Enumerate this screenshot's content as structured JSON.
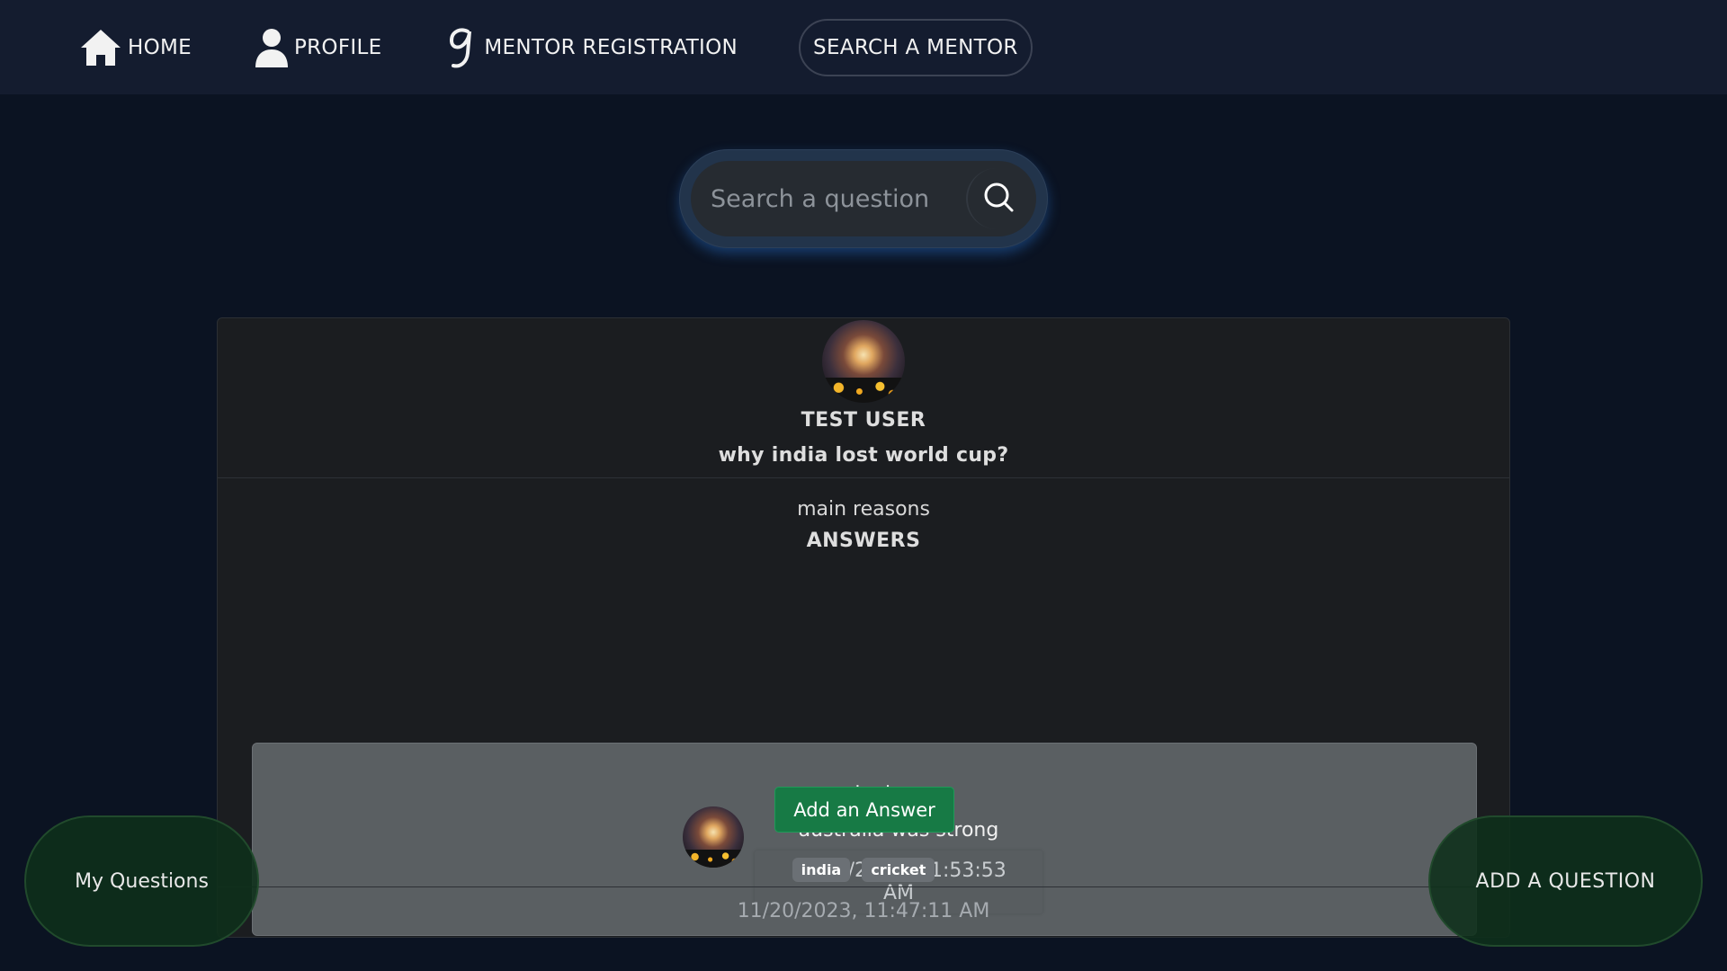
{
  "nav": {
    "items": [
      {
        "label": "HOME",
        "icon": "home-icon"
      },
      {
        "label": "PROFILE",
        "icon": "user-icon"
      },
      {
        "label": "MENTOR REGISTRATION",
        "icon": "g-logo-icon"
      },
      {
        "label": "SEARCH A MENTOR"
      }
    ]
  },
  "search": {
    "placeholder": "Search a question",
    "icon": "search-icon"
  },
  "question_card": {
    "author": "TEST USER",
    "title": "why india lost world cup?",
    "description": "main reasons",
    "answers_heading": "ANSWERS",
    "answers": [
      {
        "user": "test user",
        "text": "australia was strong",
        "time": "11/20/2023, 11:53:53 AM"
      }
    ],
    "add_answer_label": "Add an Answer",
    "tags": [
      "india",
      "cricket"
    ],
    "created_at": "11/20/2023, 11:47:11 AM"
  },
  "floating": {
    "my_questions": "My Questions",
    "add_question": "ADD A QUESTION"
  },
  "colors": {
    "background": "#0b1322",
    "nav_bg": "#141c2f",
    "accent_green": "#177a45"
  }
}
